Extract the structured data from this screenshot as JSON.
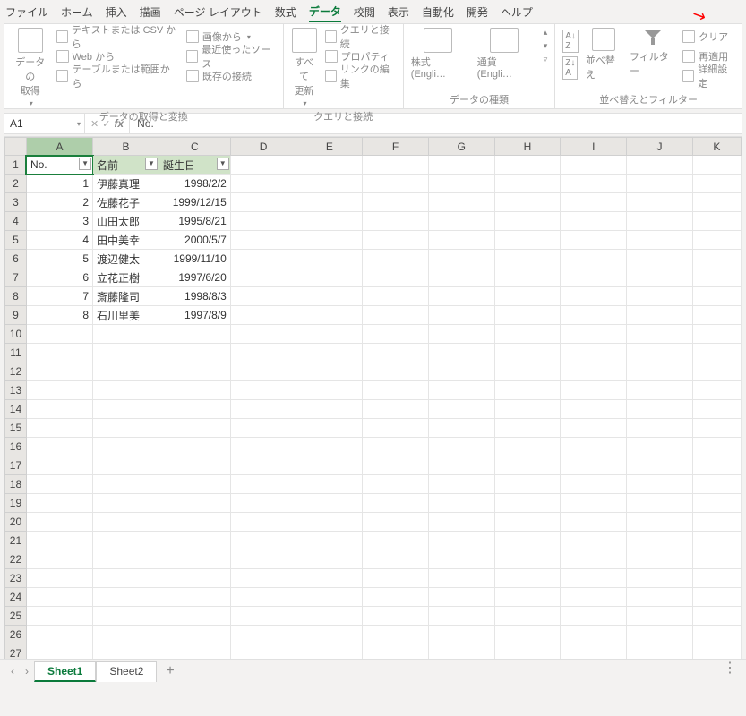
{
  "tabs": [
    "ファイル",
    "ホーム",
    "挿入",
    "描画",
    "ページ レイアウト",
    "数式",
    "データ",
    "校閲",
    "表示",
    "自動化",
    "開発",
    "ヘルプ"
  ],
  "active_tab": "データ",
  "ribbon": {
    "group1": {
      "label": "データの取得と変換",
      "big": "データの\n取得",
      "items": [
        "テキストまたは CSV から",
        "Web から",
        "テーブルまたは範囲から",
        "画像から",
        "最近使ったソース",
        "既存の接続"
      ]
    },
    "group2": {
      "label": "クエリと接続",
      "big": "すべて\n更新",
      "items": [
        "クエリと接続",
        "プロパティ",
        "リンクの編集"
      ]
    },
    "group3": {
      "label": "データの種類",
      "items": [
        "株式 (Engli…",
        "通貨 (Engli…"
      ]
    },
    "group4": {
      "label": "並べ替えとフィルター",
      "sort": "並べ替え",
      "filter": "フィルター",
      "items": [
        "クリア",
        "再適用",
        "詳細設定"
      ]
    }
  },
  "namebox": "A1",
  "formula": "No.",
  "columns": [
    "A",
    "B",
    "C",
    "D",
    "E",
    "F",
    "G",
    "H",
    "I",
    "J",
    "K"
  ],
  "headers": [
    "No.",
    "名前",
    "誕生日"
  ],
  "rows": [
    {
      "no": 1,
      "name": "伊藤真理",
      "date": "1998/2/2"
    },
    {
      "no": 2,
      "name": "佐藤花子",
      "date": "1999/12/15"
    },
    {
      "no": 3,
      "name": "山田太郎",
      "date": "1995/8/21"
    },
    {
      "no": 4,
      "name": "田中美幸",
      "date": "2000/5/7"
    },
    {
      "no": 5,
      "name": "渡辺健太",
      "date": "1999/11/10"
    },
    {
      "no": 6,
      "name": "立花正樹",
      "date": "1997/6/20"
    },
    {
      "no": 7,
      "name": "斎藤隆司",
      "date": "1998/8/3"
    },
    {
      "no": 8,
      "name": "石川里美",
      "date": "1997/8/9"
    }
  ],
  "sheets": [
    "Sheet1",
    "Sheet2"
  ],
  "active_sheet": "Sheet1"
}
